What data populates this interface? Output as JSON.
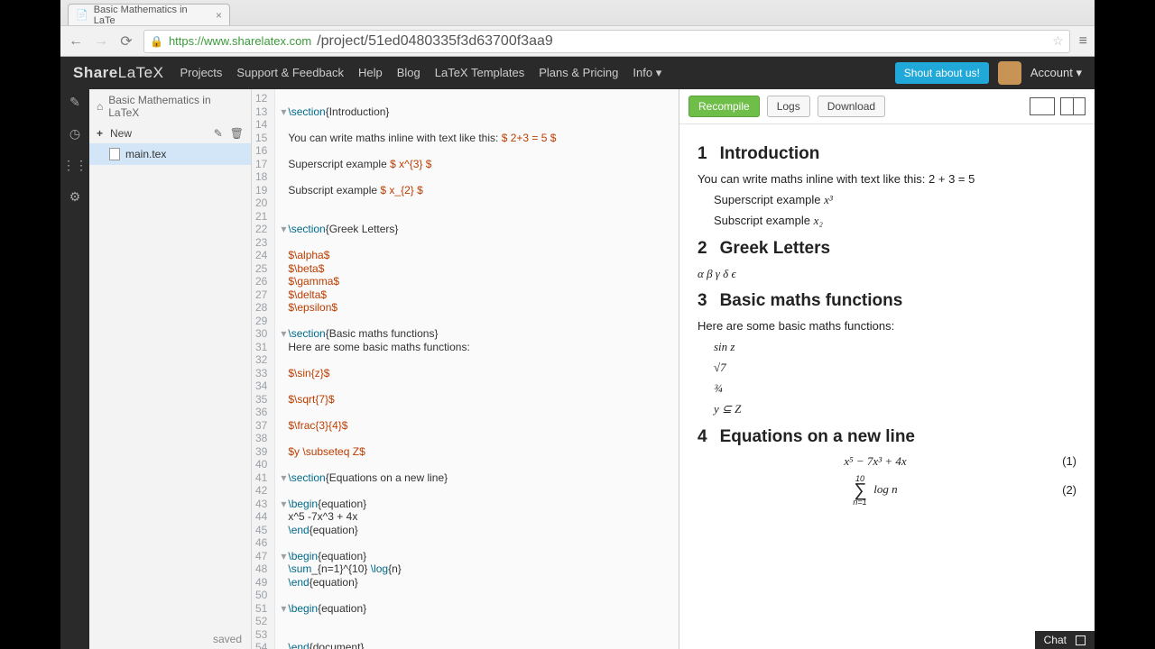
{
  "browser": {
    "tab_title": "Basic Mathematics in LaTe",
    "url_host": "https://www.sharelatex.com",
    "url_path": "/project/51ed0480335f3d63700f3aa9"
  },
  "topbar": {
    "logo_a": "Share",
    "logo_b": "LaTeX",
    "nav": [
      "Projects",
      "Support & Feedback",
      "Help",
      "Blog",
      "LaTeX Templates",
      "Plans & Pricing",
      "Info"
    ],
    "shout": "Shout about us!",
    "account": "Account"
  },
  "filepanel": {
    "project_name": "Basic Mathematics in LaTeX",
    "new_label": "New",
    "file": "main.tex",
    "saved": "saved"
  },
  "editor": {
    "first_line": 12,
    "fold_lines": [
      13,
      22,
      30,
      41,
      43,
      47,
      51
    ],
    "lines": [
      "",
      "\\section{Introduction}",
      "",
      "You can write maths inline with text like this: $ 2+3 = 5 $",
      "",
      "Superscript example $ x^{3} $",
      "",
      "Subscript example $ x_{2} $",
      "",
      "",
      "\\section{Greek Letters}",
      "",
      "$\\alpha$",
      "$\\beta$",
      "$\\gamma$",
      "$\\delta$",
      "$\\epsilon$",
      "",
      "\\section{Basic maths functions}",
      "Here are some basic maths functions:",
      "",
      "$\\sin{z}$",
      "",
      "$\\sqrt{7}$",
      "",
      "$\\frac{3}{4}$",
      "",
      "$y \\subseteq Z$",
      "",
      "\\section{Equations on a new line}",
      "",
      "\\begin{equation}",
      "x^5 -7x^3 + 4x",
      "\\end{equation}",
      "",
      "\\begin{equation}",
      "\\sum_{n=1}^{10} \\log{n}",
      "\\end{equation}",
      "",
      "\\begin{equation}",
      "",
      "",
      "\\end{document}"
    ]
  },
  "preview_toolbar": {
    "recompile": "Recompile",
    "logs": "Logs",
    "download": "Download"
  },
  "preview": {
    "s1_num": "1",
    "s1_title": "Introduction",
    "s1_line1": "You can write maths inline with text like this: 2 + 3 = 5",
    "s1_line2": "Superscript example ",
    "s1_line2_math": "x³",
    "s1_line3": "Subscript example ",
    "s1_line3_math": "x₂",
    "s2_num": "2",
    "s2_title": "Greek Letters",
    "s2_body": "α β γ δ ϵ",
    "s3_num": "3",
    "s3_title": "Basic maths functions",
    "s3_intro": "Here are some basic maths functions:",
    "s3_l1": "sin z",
    "s3_l2": "√7",
    "s3_l3": "¾",
    "s3_l4": "y ⊆ Z",
    "s4_num": "4",
    "s4_title": "Equations on a new line",
    "eq1": "x⁵ − 7x³ + 4x",
    "eq1n": "(1)",
    "eq2_top": "10",
    "eq2_sym": "∑",
    "eq2_bot": "n=1",
    "eq2_r": "log n",
    "eq2n": "(2)"
  },
  "chat": "Chat"
}
